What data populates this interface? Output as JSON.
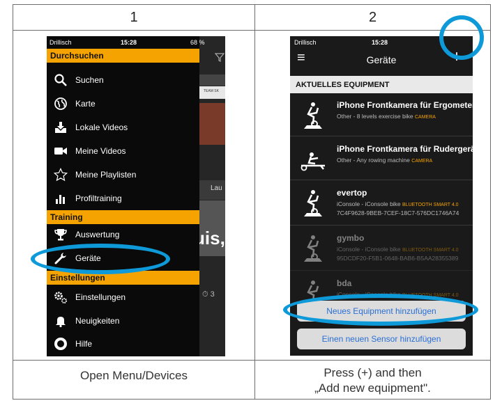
{
  "table": {
    "headers": [
      "1",
      "2"
    ],
    "captions": [
      "Open Menu/Devices",
      "Press (+) and then",
      "„Add new equipment\"."
    ]
  },
  "phone1": {
    "status": {
      "carrier": "Drillisch",
      "time": "15:28",
      "battery": "68 %"
    },
    "sections": [
      "Durchsuchen",
      "Training",
      "Einstellungen"
    ],
    "browse_items": [
      "Suchen",
      "Karte",
      "Lokale Videos",
      "Meine Videos",
      "Meine Playlisten",
      "Profiltraining"
    ],
    "training_items": [
      "Auswertung",
      "Geräte"
    ],
    "settings_items": [
      "Einstellungen",
      "Neuigkeiten",
      "Hilfe"
    ],
    "background": {
      "text1": "TEAM SK",
      "text2": "Lau",
      "text3": "uis,",
      "text4": "⏱ 3"
    }
  },
  "phone2": {
    "status": {
      "carrier": "Drillisch",
      "time": "15:28"
    },
    "nav": {
      "title": "Geräte",
      "add": "+",
      "menu": "≡"
    },
    "section": "AKTUELLES EQUIPMENT",
    "equipment": [
      {
        "name": "iPhone Frontkamera für Ergometer",
        "sub": "Other - 8 levels exercise bike",
        "tag": "CAMERA",
        "id": ""
      },
      {
        "name": "iPhone Frontkamera für Rudergeräte",
        "sub": "Other - Any rowing machine",
        "tag": "CAMERA",
        "id": ""
      },
      {
        "name": "evertop",
        "sub": "iConsole - iConsole bike",
        "tag": "BLUETOOTH SMART 4.0",
        "id": "7C4F9628-9BEB-7CEF-18C7-576DC1746A74"
      },
      {
        "name": "gymbo",
        "sub": "iConsole - iConsole bike",
        "tag": "BLUETOOTH SMART 4.0",
        "id": "95DCDF20-F5B1-0648-BAB6-B5AA28355389"
      },
      {
        "name": "bda",
        "sub": "iConsole - iConsole bike",
        "tag": "BLUETOOTH SMART 4.0",
        "id": ""
      }
    ],
    "sheet": {
      "add_equipment": "Neues Equipment hinzufügen",
      "add_sensor": "Einen neuen Sensor hinzufügen"
    }
  },
  "colors": {
    "accent": "#f5a300",
    "highlight": "#0e9ad9",
    "link": "#2a6fd6"
  }
}
